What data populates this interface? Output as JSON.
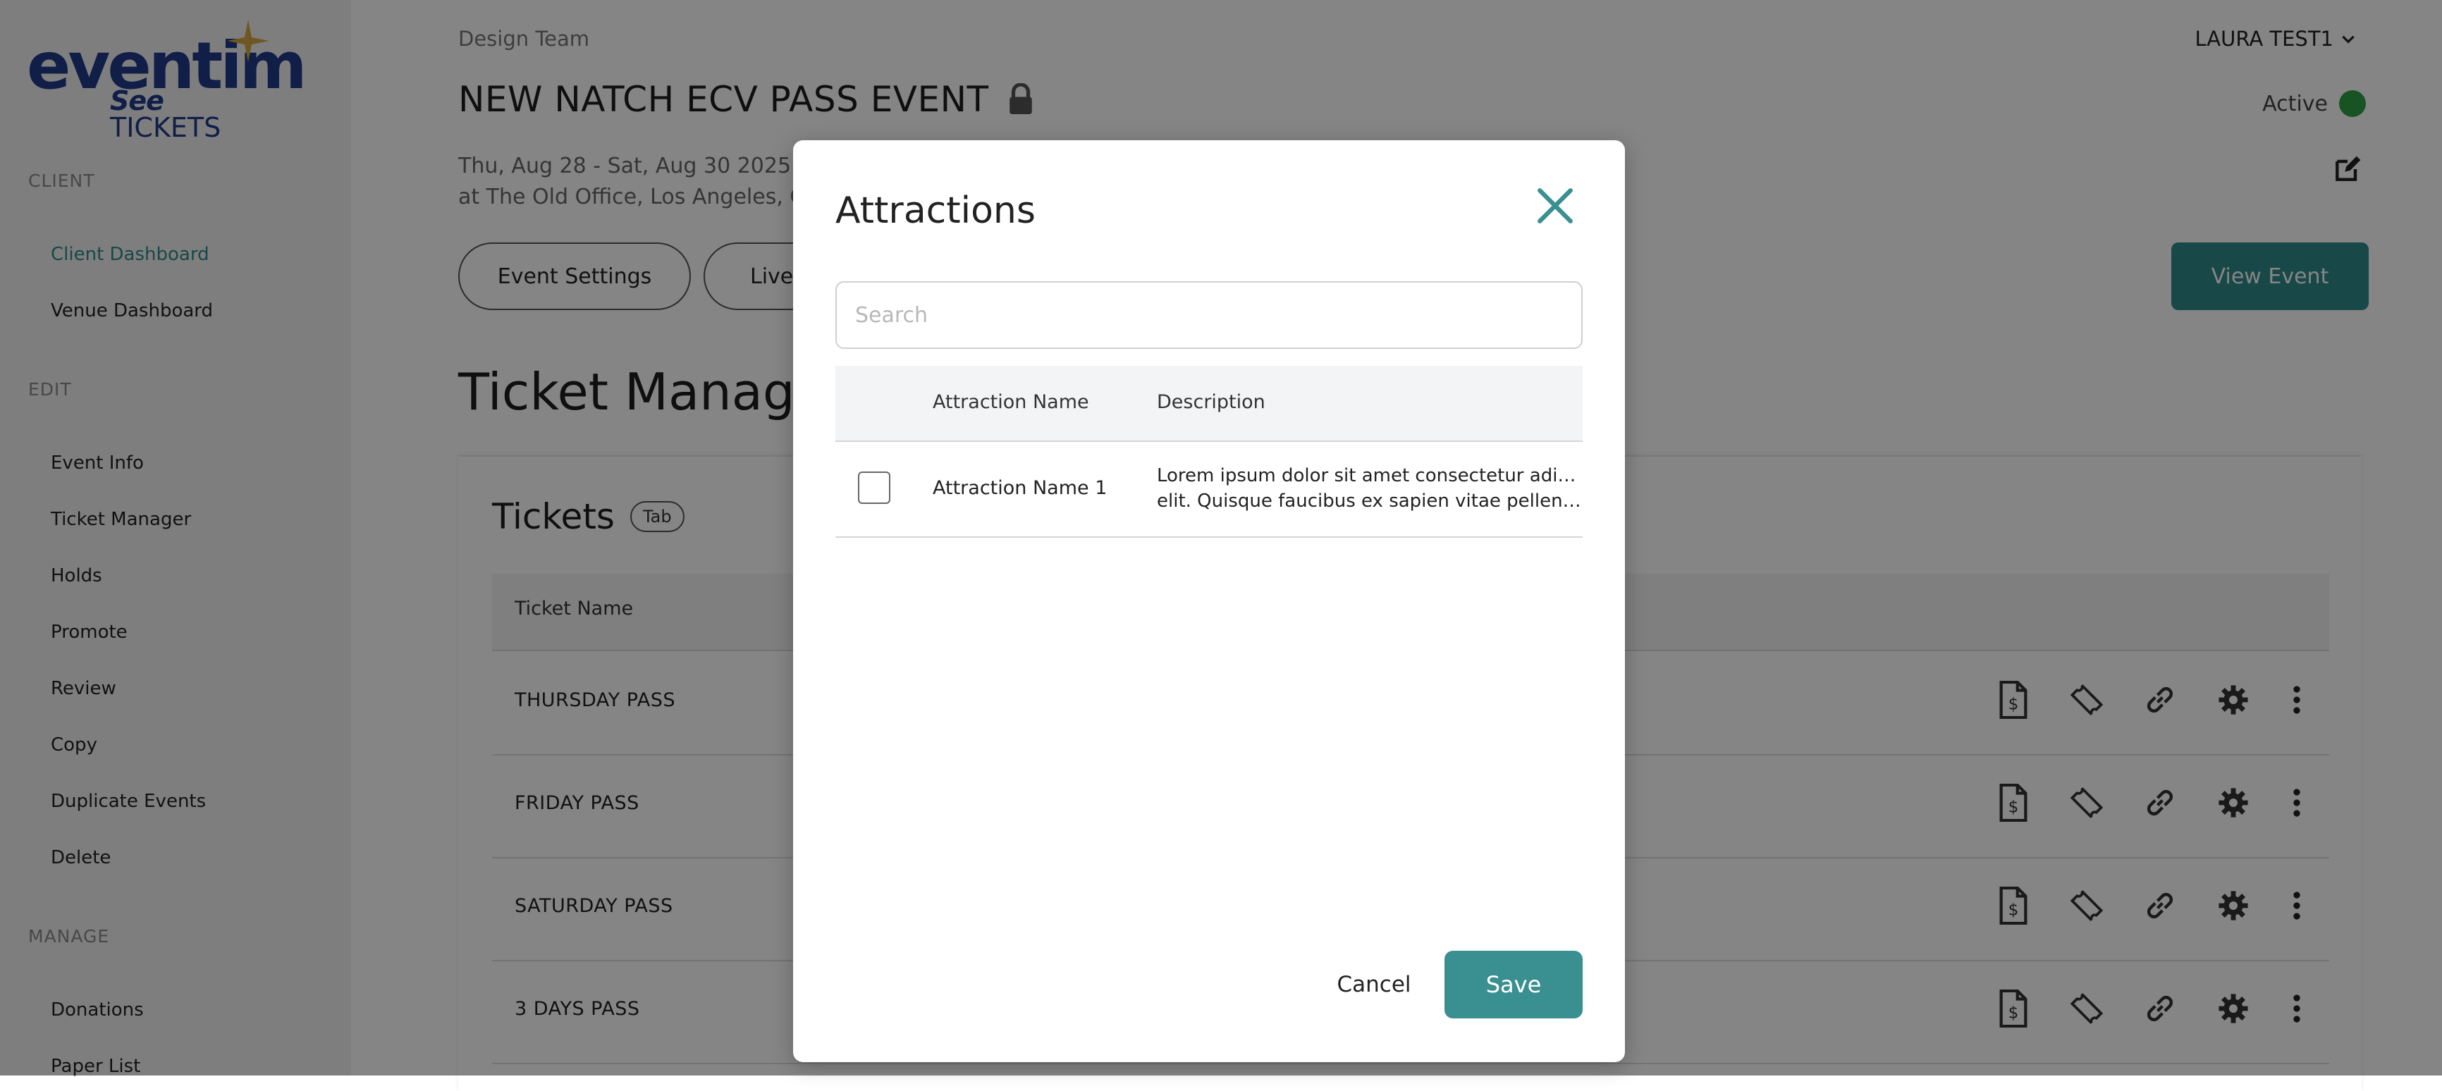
{
  "brand": {
    "logo_main": "eventim",
    "logo_see": "See",
    "logo_tickets": "TICKETS",
    "color": "#1f3a8a",
    "star_color": "#d6a740"
  },
  "sidebar": {
    "sections": [
      {
        "label": "CLIENT",
        "items": [
          {
            "label": "Client Dashboard",
            "active": true
          },
          {
            "label": "Venue Dashboard"
          }
        ]
      },
      {
        "label": "EDIT",
        "items": [
          {
            "label": "Event Info"
          },
          {
            "label": "Ticket Manager"
          },
          {
            "label": "Holds"
          },
          {
            "label": "Promote"
          },
          {
            "label": "Review"
          },
          {
            "label": "Copy"
          },
          {
            "label": "Duplicate Events"
          },
          {
            "label": "Delete"
          }
        ]
      },
      {
        "label": "MANAGE",
        "items": [
          {
            "label": "Donations"
          },
          {
            "label": "Paper List"
          }
        ]
      }
    ]
  },
  "header": {
    "breadcrumb": "Design Team",
    "user": "LAURA TEST1",
    "event_title": "NEW NATCH ECV PASS EVENT",
    "status": "Active",
    "status_color": "#2ea043",
    "date_line": "Thu, Aug 28 - Sat, Aug 30 2025",
    "venue_line": "at The Old Office, Los Angeles, CA"
  },
  "toolbar": {
    "event_settings": "Event Settings",
    "live": "Live",
    "view_event": "View Event"
  },
  "ticket_manager": {
    "heading": "Ticket Manager",
    "card_title": "Tickets",
    "tab_badge": "Tab",
    "column_ticket_name": "Ticket Name",
    "rows": [
      {
        "name": "THURSDAY PASS"
      },
      {
        "name": "FRIDAY PASS"
      },
      {
        "name": "SATURDAY PASS"
      },
      {
        "name": "3 DAYS PASS"
      }
    ]
  },
  "modal": {
    "title": "Attractions",
    "search_placeholder": "Search",
    "columns": {
      "name": "Attraction Name",
      "description": "Description"
    },
    "rows": [
      {
        "name": "Attraction Name 1",
        "description_line1": "Lorem ipsum dolor sit amet consectetur adipiscing",
        "description_line2": "elit. Quisque faucibus ex sapien vitae pellentesqu...",
        "checked": false
      }
    ],
    "cancel_label": "Cancel",
    "save_label": "Save",
    "accent": "#3a8f91"
  }
}
